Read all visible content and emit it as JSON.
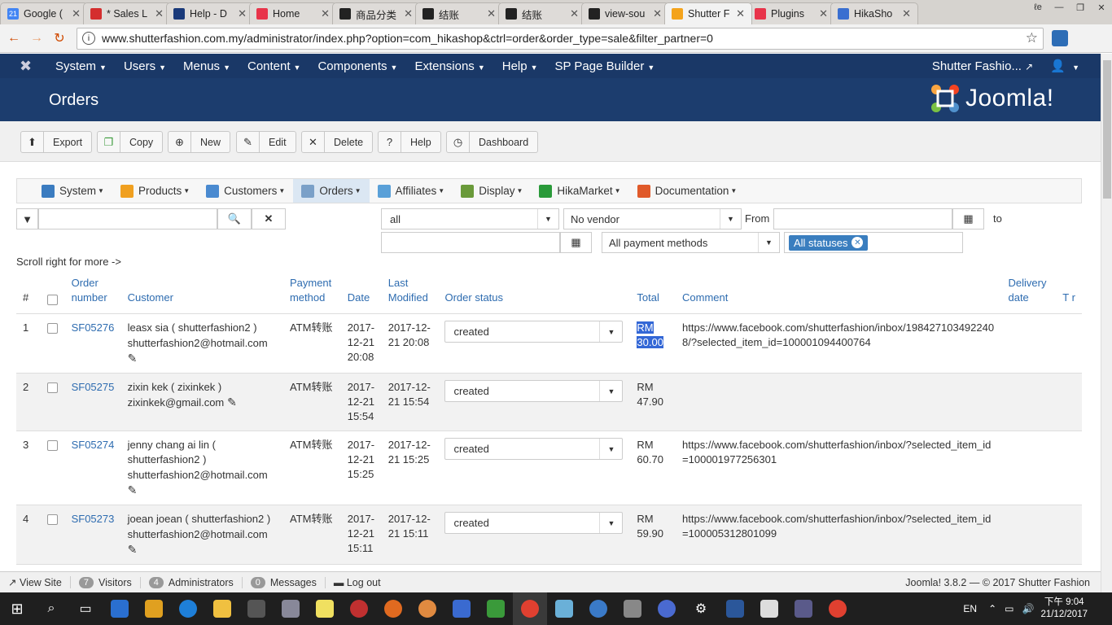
{
  "browser": {
    "tabs": [
      {
        "label": "Google (",
        "fav_color": "#4285f4",
        "fav_text": "21"
      },
      {
        "label": "* Sales L",
        "fav_color": "#d42e2e",
        "fav_text": ""
      },
      {
        "label": "Help - D",
        "fav_color": "#1a3a7a",
        "fav_text": ""
      },
      {
        "label": "Home",
        "fav_color": "#e8344a",
        "fav_text": ""
      },
      {
        "label": "商品分类",
        "fav_color": "#222222",
        "fav_text": ""
      },
      {
        "label": "结账",
        "fav_color": "#222222",
        "fav_text": ""
      },
      {
        "label": "结账",
        "fav_color": "#222222",
        "fav_text": ""
      },
      {
        "label": "view-sou",
        "fav_color": "#222222",
        "fav_text": ""
      },
      {
        "label": "Shutter F",
        "fav_color": "#f4a31c",
        "fav_text": "",
        "active": true
      },
      {
        "label": "Plugins",
        "fav_color": "#e8344a",
        "fav_text": ""
      },
      {
        "label": "HikaSho",
        "fav_color": "#3a6fd0",
        "fav_text": ""
      }
    ],
    "url": "www.shutterfashion.com.my/administrator/index.php?option=com_hikashop&ctrl=order&order_type=sale&filter_partner=0"
  },
  "topmenu": {
    "items": [
      "System",
      "Users",
      "Menus",
      "Content",
      "Components",
      "Extensions",
      "Help",
      "SP Page Builder"
    ],
    "site_name": "Shutter Fashio..."
  },
  "header": {
    "title": "Orders",
    "brand": "Joomla!"
  },
  "toolbar": {
    "buttons": [
      "Export",
      "Copy",
      "New",
      "Edit",
      "Delete",
      "Help",
      "Dashboard"
    ]
  },
  "subnav": {
    "items": [
      {
        "label": "System",
        "color": "#3b7cc0"
      },
      {
        "label": "Products",
        "color": "#f0a020"
      },
      {
        "label": "Customers",
        "color": "#4a8ad0"
      },
      {
        "label": "Orders",
        "color": "#7aa0c8"
      },
      {
        "label": "Affiliates",
        "color": "#5aa0d8"
      },
      {
        "label": "Display",
        "color": "#6a9a3a"
      },
      {
        "label": "HikaMarket",
        "color": "#2a9a3a"
      },
      {
        "label": "Documentation",
        "color": "#e05a2a"
      }
    ]
  },
  "filters": {
    "search_value": "",
    "type_value": "all",
    "vendor_value": "No vendor",
    "from_label": "From",
    "to_label": "to",
    "payment_value": "All payment methods",
    "status_tag": "All statuses"
  },
  "scroll_hint": "Scroll right for more ->",
  "table": {
    "headers": {
      "num": "#",
      "order_number": "Order number",
      "customer": "Customer",
      "payment": "Payment method",
      "date": "Date",
      "modified": "Last Modified",
      "status": "Order status",
      "total": "Total",
      "comment": "Comment",
      "delivery": "Delivery date",
      "extra": "T r"
    },
    "rows": [
      {
        "num": "1",
        "order": "SF05276",
        "customer": "leasx sia ( shutterfashion2 )",
        "email": "shutterfashion2@hotmail.com",
        "payment": "ATM转账",
        "date": "2017-12-21 20:08",
        "modified": "2017-12-21 20:08",
        "status": "created",
        "total": "RM 30.00",
        "comment": "https://www.facebook.com/shutterfashion/inbox/1984271034922408/?selected_item_id=100001094400764"
      },
      {
        "num": "2",
        "order": "SF05275",
        "customer": "zixin kek ( zixinkek )",
        "email": "zixinkek@gmail.com",
        "payment": "ATM转账",
        "date": "2017-12-21 15:54",
        "modified": "2017-12-21 15:54",
        "status": "created",
        "total": "RM 47.90",
        "comment": ""
      },
      {
        "num": "3",
        "order": "SF05274",
        "customer": "jenny chang ai lin ( shutterfashion2 )",
        "email": "shutterfashion2@hotmail.com",
        "payment": "ATM转账",
        "date": "2017-12-21 15:25",
        "modified": "2017-12-21 15:25",
        "status": "created",
        "total": "RM 60.70",
        "comment": "https://www.facebook.com/shutterfashion/inbox/?selected_item_id=100001977256301"
      },
      {
        "num": "4",
        "order": "SF05273",
        "customer": "joean joean ( shutterfashion2 )",
        "email": "shutterfashion2@hotmail.com",
        "payment": "ATM转账",
        "date": "2017-12-21 15:11",
        "modified": "2017-12-21 15:11",
        "status": "created",
        "total": "RM 59.90",
        "comment": "https://www.facebook.com/shutterfashion/inbox/?selected_item_id=100005312801099"
      }
    ]
  },
  "statusbar": {
    "view_site": "View Site",
    "visitors_count": "7",
    "visitors": "Visitors",
    "admins_count": "4",
    "admins": "Administrators",
    "messages_count": "0",
    "messages": "Messages",
    "logout": "Log out",
    "version": "Joomla! 3.8.2 — © 2017 Shutter Fashion"
  },
  "taskbar": {
    "lang": "EN",
    "time": "下午 9:04",
    "date": "21/12/2017"
  }
}
